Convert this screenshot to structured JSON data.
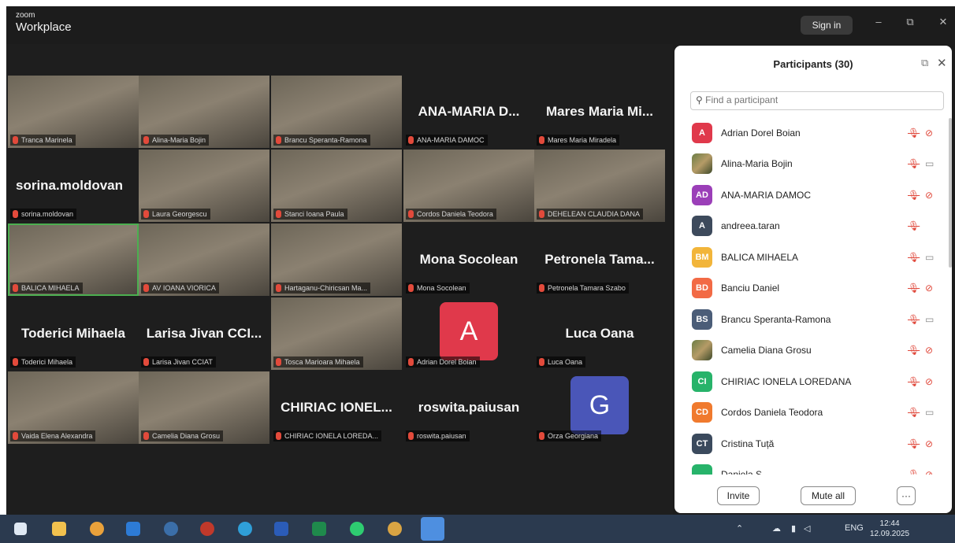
{
  "app": {
    "brand_small": "zoom",
    "brand_main": "Workplace",
    "sign_in_label": "Sign in"
  },
  "window_controls": {
    "minimize": "–",
    "restore": "⧉",
    "close": "✕"
  },
  "gallery": [
    {
      "caption": "Tranca Marinela",
      "video": true
    },
    {
      "caption": "Alina-Maria Bojin",
      "video": true
    },
    {
      "caption": "Brancu Speranta-Ramona",
      "video": true
    },
    {
      "caption": "ANA-MARIA DAMOC",
      "display": "ANA-MARIA D..."
    },
    {
      "caption": "Mares Maria Miradela",
      "display": "Mares Maria Mi..."
    },
    {
      "caption": "sorina.moldovan",
      "display": "sorina.moldovan"
    },
    {
      "caption": "Laura Georgescu",
      "video": true
    },
    {
      "caption": "Stanci Ioana Paula",
      "video": true
    },
    {
      "caption": "Cordos Daniela Teodora",
      "video": true
    },
    {
      "caption": "DEHELEAN CLAUDIA DANA",
      "video": true
    },
    {
      "caption": "BALICA MIHAELA",
      "video": true
    },
    {
      "caption": "AV IOANA VIORICA",
      "video": true
    },
    {
      "caption": "Hartaganu-Chiricsan Ma...",
      "video": true
    },
    {
      "caption": "Mona Socolean",
      "display": "Mona Socolean"
    },
    {
      "caption": "Petronela Tamara Szabo",
      "display": "Petronela Tama..."
    },
    {
      "caption": "Toderici Mihaela",
      "display": "Toderici Mihaela"
    },
    {
      "caption": "Larisa Jivan CCIAT",
      "display": "Larisa Jivan CCI..."
    },
    {
      "caption": "Tosca Marioara Mihaela",
      "video": true
    },
    {
      "caption": "Adrian Dorel Boian",
      "avatar": "A",
      "avatar_color": "#e0394b"
    },
    {
      "caption": "Luca Oana",
      "display": "Luca Oana"
    },
    {
      "caption": "Vaida Elena Alexandra",
      "video": true
    },
    {
      "caption": "Camelia Diana Grosu",
      "video": true
    },
    {
      "caption": "CHIRIAC IONELA LOREDA...",
      "display": "CHIRIAC IONEL..."
    },
    {
      "caption": "roswita.paiusan",
      "display": "roswita.paiusan"
    },
    {
      "caption": "Orza Georgiana",
      "avatar": "G",
      "avatar_color": "#4a56b8"
    }
  ],
  "participants_panel": {
    "title": "Participants (30)",
    "search_placeholder": "Find a participant",
    "participants": [
      {
        "name": "Adrian Dorel Boian",
        "initials": "A",
        "color": "#e0394b",
        "mic": "muted",
        "camera": "off"
      },
      {
        "name": "Alina-Maria Bojin",
        "initials": "",
        "photo": true,
        "mic": "muted",
        "camera": "on"
      },
      {
        "name": "ANA-MARIA DAMOC",
        "initials": "AD",
        "color": "#9b3fb8",
        "mic": "muted",
        "camera": "off"
      },
      {
        "name": "andreea.taran",
        "initials": "A",
        "color": "#3d4a5c",
        "mic": "muted",
        "camera": ""
      },
      {
        "name": "BALICA MIHAELA",
        "initials": "BM",
        "color": "#f2b53a",
        "mic": "muted",
        "camera": "on"
      },
      {
        "name": "Banciu Daniel",
        "initials": "BD",
        "color": "#f26a45",
        "mic": "muted",
        "camera": "off"
      },
      {
        "name": "Brancu Speranta-Ramona",
        "initials": "BS",
        "color": "#4b5d78",
        "mic": "muted",
        "camera": "on"
      },
      {
        "name": "Camelia Diana Grosu",
        "initials": "",
        "photo": true,
        "mic": "muted",
        "camera": "off"
      },
      {
        "name": "CHIRIAC IONELA LOREDANA",
        "initials": "CI",
        "color": "#27b36a",
        "mic": "muted",
        "camera": "off"
      },
      {
        "name": "Cordos Daniela Teodora",
        "initials": "CD",
        "color": "#f07a2e",
        "mic": "muted",
        "camera": "on"
      },
      {
        "name": "Cristina Tuță",
        "initials": "CT",
        "color": "#3b4a5d",
        "mic": "muted",
        "camera": "off"
      },
      {
        "name": "Daniela S...",
        "initials": "",
        "color": "#27b36a",
        "mic": "muted",
        "camera": "off"
      }
    ],
    "invite_label": "Invite",
    "mute_all_label": "Mute all",
    "more_label": "···"
  },
  "taskbar": {
    "language": "ENG",
    "time": "12:44",
    "date": "12.09.2025"
  },
  "colors": {
    "window_bg": "#1c1c1c",
    "taskbar_bg": "#2b3a4f",
    "muted_red": "#e0483b",
    "active_border": "#4caf50"
  }
}
